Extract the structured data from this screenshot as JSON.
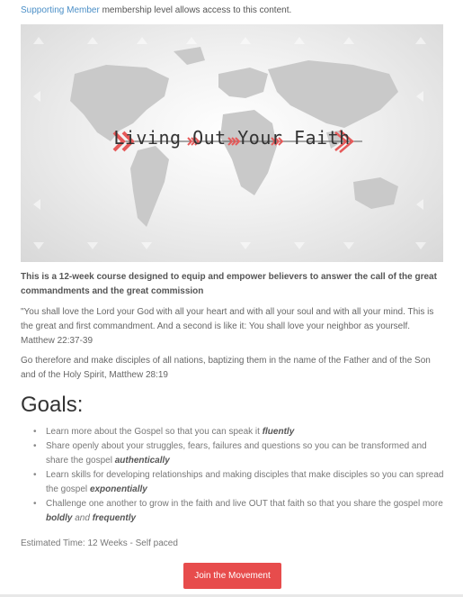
{
  "notice": {
    "link_text": "Supporting Member",
    "text": " membership level allows access to this content."
  },
  "hero": {
    "title": "Living Out Your Faith"
  },
  "intro": "This is a 12-week course designed to equip and empower believers to answer the call of the great commandments and the great commission",
  "quote": "\"You shall love the Lord your God with all your heart and with all your soul and with all your mind. This is the great and first commandment.  And a second is like it: You shall love your neighbor as yourself. Matthew 22:37-39",
  "commission": "Go therefore and make disciples of all nations, baptizing them in the name of the Father and of the Son and of the Holy Spirit, Matthew 28:19",
  "goals": {
    "title": "Goals:",
    "items": [
      {
        "text": "Learn more about the Gospel so that you can speak it ",
        "em": "fluently"
      },
      {
        "text": "Share openly about your struggles, fears, failures and questions so you can be transformed and share the gospel ",
        "em": "authentically"
      },
      {
        "text": "Learn skills for developing relationships and making disciples that make disciples so you can spread the gospel ",
        "em": "exponentially"
      },
      {
        "text": "Challenge one another to grow in the faith and live OUT that faith so that you share the gospel more ",
        "em": "boldly",
        "mid": " and ",
        "em2": "frequently"
      }
    ]
  },
  "estimate": "Estimated Time: 12 Weeks - Self paced",
  "cta_label": "Join the Movement",
  "colors": {
    "accent": "#e74c4c",
    "link": "#4b8fc7"
  }
}
